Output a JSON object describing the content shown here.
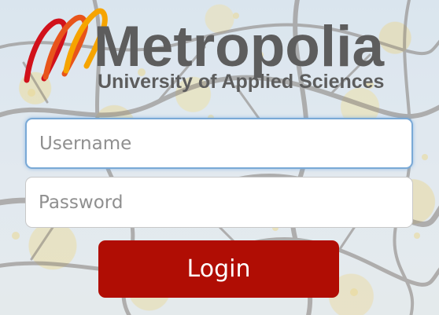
{
  "brand": {
    "name": "Metropolia",
    "tagline": "University of Applied Sciences",
    "text_color": "#5d5d5d",
    "logo_colors": [
      "#f6a400",
      "#e8541b",
      "#d1111b"
    ]
  },
  "form": {
    "username_placeholder": "Username",
    "password_placeholder": "Password",
    "login_label": "Login",
    "accent_color": "#b00d04",
    "focus_color": "#7aa9d6"
  }
}
